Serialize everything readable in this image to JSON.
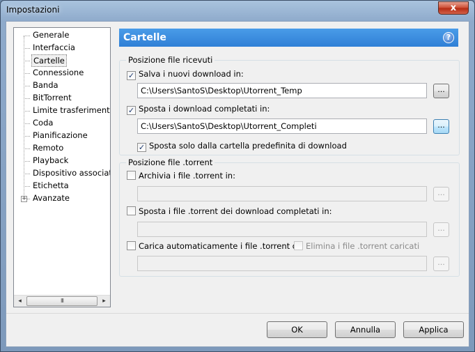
{
  "window": {
    "title": "Impostazioni",
    "close_label": "x"
  },
  "sidebar": {
    "items": [
      {
        "label": "Generale"
      },
      {
        "label": "Interfaccia"
      },
      {
        "label": "Cartelle"
      },
      {
        "label": "Connessione"
      },
      {
        "label": "Banda"
      },
      {
        "label": "BitTorrent"
      },
      {
        "label": "Limite trasferimento"
      },
      {
        "label": "Coda"
      },
      {
        "label": "Pianificazione"
      },
      {
        "label": "Remoto"
      },
      {
        "label": "Playback"
      },
      {
        "label": "Dispositivo associato"
      },
      {
        "label": "Etichetta"
      },
      {
        "label": "Avanzate"
      }
    ],
    "selected": "Cartelle",
    "expander": "+",
    "scroll_left": "◂",
    "scroll_right": "▸",
    "scroll_thumb": "III"
  },
  "header": {
    "title": "Cartelle",
    "help": "?"
  },
  "received": {
    "title": "Posizione file ricevuti",
    "save_new_label": "Salva i nuovi download in:",
    "save_new_checked": true,
    "save_new_path": "C:\\Users\\SantoS\\Desktop\\Utorrent_Temp",
    "move_completed_label": "Sposta i download completati in:",
    "move_completed_checked": true,
    "move_completed_path": "C:\\Users\\SantoS\\Desktop\\Utorrent_Completi",
    "move_default_only_label": "Sposta solo dalla cartella predefinita di download",
    "move_default_only_checked": true,
    "browse_label": "..."
  },
  "torrent": {
    "title": "Posizione file .torrent",
    "archive_label": "Archivia i file .torrent in:",
    "move_torrent_label": "Sposta i file .torrent dei download completati in:",
    "autoload_label": "Carica automaticamente i file .torrent da",
    "delete_loaded_label": "Elimina i file .torrent caricati",
    "browse_label": "..."
  },
  "check_mark": "✓",
  "buttons": {
    "ok": "OK",
    "cancel": "Annulla",
    "apply": "Applica"
  }
}
